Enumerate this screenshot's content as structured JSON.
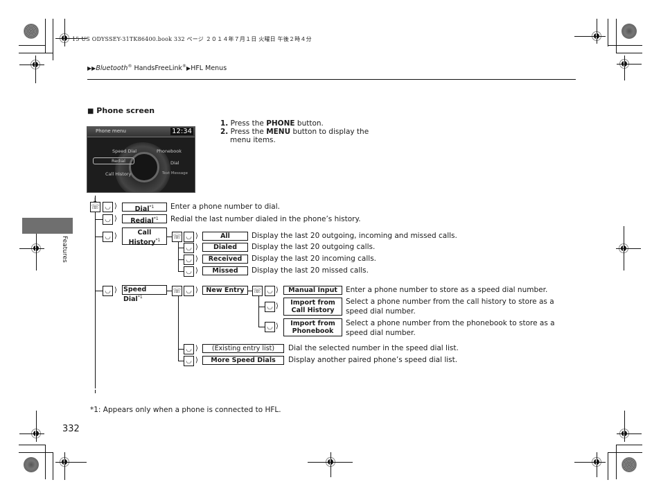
{
  "print_header": "15 US ODYSSEY-31TK86400.book  332 ページ  ２０１４年７月１日  火曜日  午後２時４分",
  "breadcrumb": {
    "arrows": "▶▶",
    "part1_italic": "Bluetooth",
    "reg1": "®",
    "part2": " HandsFreeLink",
    "reg2": "®",
    "sep": "▶",
    "part3": "HFL Menus"
  },
  "side_tab": {
    "label": "Features",
    "color": "#6f6f6f"
  },
  "section": {
    "bullet": "■",
    "title": "Phone screen"
  },
  "steps": [
    {
      "num": "1.",
      "pre": "Press the ",
      "bold": "PHONE",
      "post": " button."
    },
    {
      "num": "2.",
      "pre": "Press the ",
      "bold": "MENU",
      "post": " button to display the",
      "cont": "menu items."
    }
  ],
  "screen": {
    "title": "Phone menu",
    "clock": "12:34",
    "items": [
      "Speed Dial",
      "Phonebook",
      "Redial",
      "Dial",
      "Call History",
      "Text Message"
    ]
  },
  "tree": {
    "dial": {
      "label": "Dial",
      "sup": "*1",
      "desc": "Enter a phone number to dial."
    },
    "redial": {
      "label": "Redial",
      "sup": "*1",
      "desc": "Redial the last number dialed in the phone’s history."
    },
    "call_history": {
      "label1": "Call",
      "label2": "History",
      "sup": "*1",
      "children": [
        {
          "label": "All",
          "desc": "Display the last 20 outgoing, incoming and missed calls."
        },
        {
          "label": "Dialed",
          "desc": "Display the last 20 outgoing calls."
        },
        {
          "label": "Received",
          "desc": "Display the last 20 incoming calls."
        },
        {
          "label": "Missed",
          "desc": "Display the last 20 missed calls."
        }
      ]
    },
    "speed_dial": {
      "label": "Speed Dial",
      "sup": "*1",
      "new_entry": {
        "label": "New Entry",
        "children": [
          {
            "label": "Manual Input",
            "desc": "Enter a phone number to store as a speed dial number."
          },
          {
            "label1": "Import from",
            "label2": "Call History",
            "desc1": "Select a phone number from the call history to store as a",
            "desc2": "speed dial number."
          },
          {
            "label1": "Import from",
            "label2": "Phonebook",
            "desc1": "Select a phone number from the phonebook to store as a",
            "desc2": "speed dial number."
          }
        ]
      },
      "existing": {
        "label": "(Existing entry list)",
        "desc": "Dial the selected number in the speed dial list."
      },
      "more": {
        "label": "More Speed Dials",
        "desc": "Display another paired phone’s speed dial list."
      }
    },
    "icons": {
      "press": "phone-button-icon",
      "select": "interface-dial-icon",
      "press_glyph": "☏",
      "select_glyph": "◡",
      "arrow": "⟩"
    }
  },
  "footnote": "*1: Appears only when a phone is connected to HFL.",
  "page_number": "332"
}
